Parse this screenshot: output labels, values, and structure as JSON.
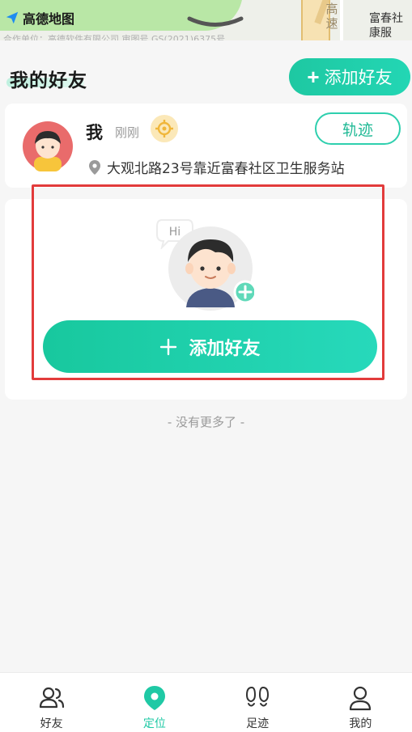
{
  "map": {
    "brand": "高德地图",
    "copyright": "合作单位：高德软件有限公司 审图号 GS(2021)6375号",
    "road_label": "高速",
    "place_label": "富春社康服"
  },
  "header": {
    "title": "我的好友",
    "add_friend_label": "添加好友"
  },
  "me": {
    "name": "我",
    "time": "刚刚",
    "trail_label": "轨迹",
    "address": "大观北路23号靠近富春社区卫生服务站"
  },
  "invite": {
    "hi_text": "Hi",
    "add_friend_label": "添加好友"
  },
  "list_end_text": "- 没有更多了 -",
  "tabbar": {
    "items": [
      {
        "label": "好友",
        "icon": "friends-icon",
        "active": false
      },
      {
        "label": "定位",
        "icon": "location-pin-icon",
        "active": true
      },
      {
        "label": "足迹",
        "icon": "footprints-icon",
        "active": false
      },
      {
        "label": "我的",
        "icon": "profile-icon",
        "active": false
      }
    ]
  },
  "colors": {
    "accent": "#1fc9a5",
    "highlight": "#e23b3b",
    "badge": "#fbe8b8"
  }
}
